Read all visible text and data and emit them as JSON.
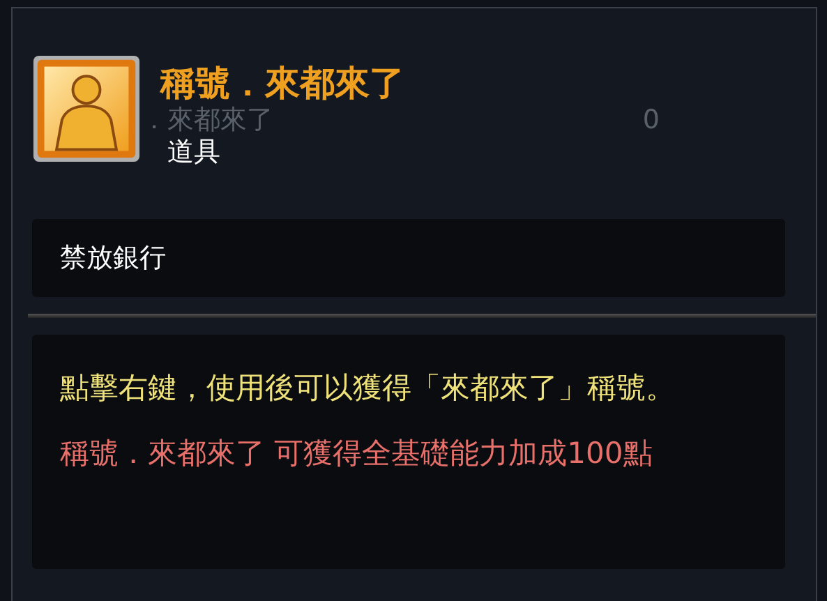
{
  "background_row": {
    "name": "．來都來了",
    "count": "0"
  },
  "tooltip": {
    "title": "稱號．來都來了",
    "type": "道具",
    "restriction": "禁放銀行",
    "description": "點擊右鍵，使用後可以獲得「來都來了」稱號。",
    "effect": "稱號．來都來了 可獲得全基礎能力加成100點"
  }
}
